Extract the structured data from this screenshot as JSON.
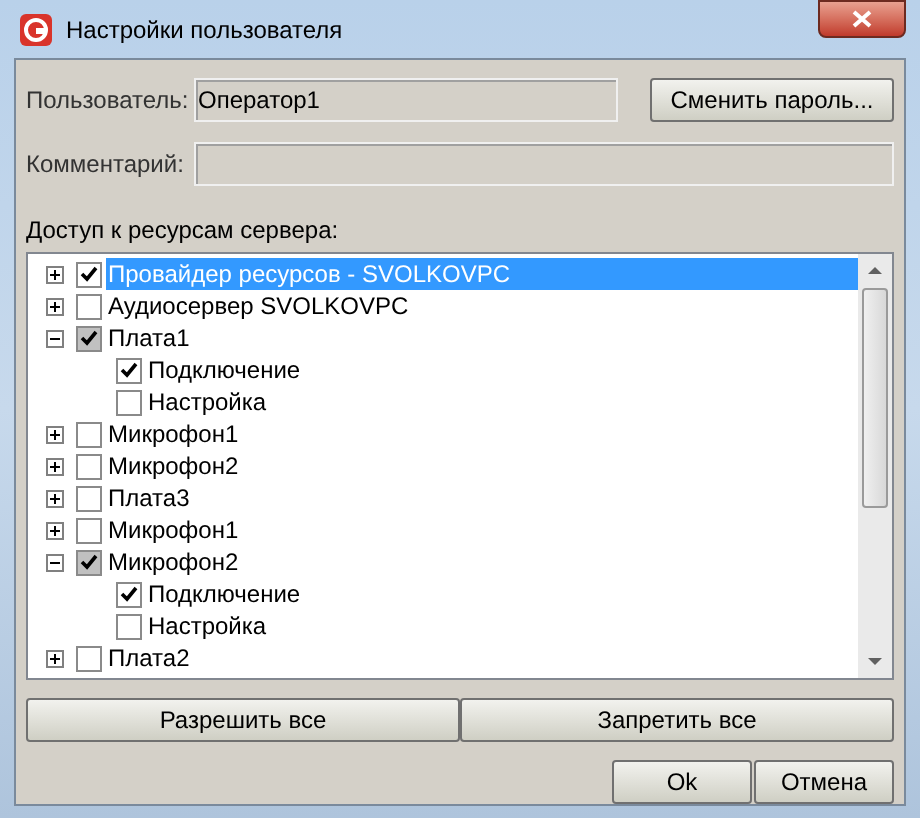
{
  "window": {
    "title": "Настройки пользователя"
  },
  "user": {
    "label": "Пользователь:",
    "value": "Оператор1"
  },
  "change_password_button": "Сменить пароль...",
  "comment": {
    "label": "Комментарий:"
  },
  "access_label": "Доступ к ресурсам сервера:",
  "tree": [
    {
      "label": "Провайдер ресурсов - SVOLKOVPC",
      "expanded": false,
      "checked": true,
      "partial": false,
      "selected": true
    },
    {
      "label": "Аудиосервер SVOLKOVPC",
      "expanded": false,
      "checked": false,
      "partial": false,
      "selected": false
    },
    {
      "label": "Плата1",
      "expanded": true,
      "checked": true,
      "partial": true,
      "selected": false,
      "children": [
        {
          "label": "Подключение",
          "checked": true,
          "partial": false,
          "selected": false
        },
        {
          "label": "Настройка",
          "checked": false,
          "partial": false,
          "selected": false
        }
      ]
    },
    {
      "label": "Микрофон1",
      "expanded": false,
      "checked": false,
      "partial": false,
      "selected": false
    },
    {
      "label": "Микрофон2",
      "expanded": false,
      "checked": false,
      "partial": false,
      "selected": false
    },
    {
      "label": "Плата3",
      "expanded": false,
      "checked": false,
      "partial": false,
      "selected": false
    },
    {
      "label": "Микрофон1",
      "expanded": false,
      "checked": false,
      "partial": false,
      "selected": false
    },
    {
      "label": "Микрофон2",
      "expanded": true,
      "checked": true,
      "partial": true,
      "selected": false,
      "children": [
        {
          "label": "Подключение",
          "checked": true,
          "partial": false,
          "selected": false
        },
        {
          "label": "Настройка",
          "checked": false,
          "partial": false,
          "selected": false
        }
      ]
    },
    {
      "label": "Плата2",
      "expanded": false,
      "checked": false,
      "partial": false,
      "selected": false
    }
  ],
  "bulk_buttons": [
    "Разрешить все",
    "Запретить все"
  ],
  "dialog_buttons": [
    "Ok",
    "Отмена"
  ]
}
